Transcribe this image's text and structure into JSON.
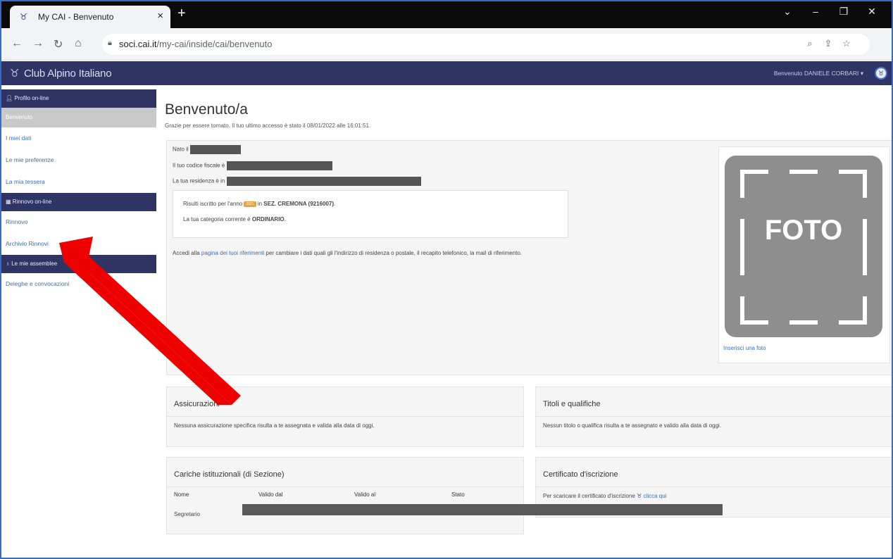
{
  "browser": {
    "tab_title": "My CAI - Benvenuto",
    "tab_close": "×",
    "new_tab": "+",
    "url_domain": "soci.cai.it",
    "url_path": "/my-cai/inside/cai/benvenuto",
    "window_controls": [
      "⌄",
      "–",
      "❐",
      "✕"
    ]
  },
  "header": {
    "brand": "Club Alpino Italiano",
    "welcome": "Benvenuto DANIELE CORBARI"
  },
  "sidebar": {
    "section_profile": "Profilo on-line",
    "active_item": "Benvenuto",
    "items_profile": [
      "I miei dati",
      "Le mie preferenze",
      "La mia tessera"
    ],
    "section_rinnovo": "Rinnovo on-line",
    "items_rinnovo": [
      "Rinnovo",
      "Archivio Rinnovi"
    ],
    "section_assemblee": "Le mie assemblee",
    "items_assemblee": [
      "Deleghe e convocazioni"
    ]
  },
  "main": {
    "title": "Benvenuto/a",
    "last_access": "Grazie per essere tornato. Il tuo ultimo accesso è stato il 08/01/2022 alle 16:01:51.",
    "nato": "Nato il",
    "codice_fiscale": "Il tuo codice fiscale è",
    "residenza": "La tua residenza è in",
    "iscritto_pre": "Risulti iscritto per l'anno",
    "iscritto_year": "2021",
    "iscritto_in": "in",
    "iscritto_section": "SEZ. CREMONA (9216007)",
    "categoria_pre": "La tua categoria corrente è",
    "categoria": "ORDINARIO",
    "access_pre": "Accedi alla",
    "access_link": "pagina dei tuoi riferimenti",
    "access_post": "per cambiare i dati quali gli l'indirizzo di residenza o postale, il recapito telefonico, la mail di riferimento.",
    "photo_label": "FOTO",
    "add_photo": "Inserisci una foto"
  },
  "panels": {
    "assicurazioni_title": "Assicurazioni",
    "assicurazioni_body": "Nessuna assicurazione specifica risulta a te assegnata e valida alla data di oggi.",
    "titoli_title": "Titoli e qualifiche",
    "titoli_body": "Nessun titolo o qualifica risulta a te assegnato e valido alla data di oggi.",
    "cariche_title": "Cariche istituzionali (di Sezione)",
    "cariche_headers": [
      "Nome",
      "Valido dal",
      "Valido al",
      "Stato"
    ],
    "cariche_row": "Segretario",
    "certificato_title": "Certificato d'iscrizione",
    "certificato_pre": "Per scaricare il certificato d'iscrizione",
    "certificato_link": "clicca qui"
  },
  "colors": {
    "header_bg": "#2e3564",
    "link": "#3a6fb6",
    "arrow": "#ee0000"
  }
}
